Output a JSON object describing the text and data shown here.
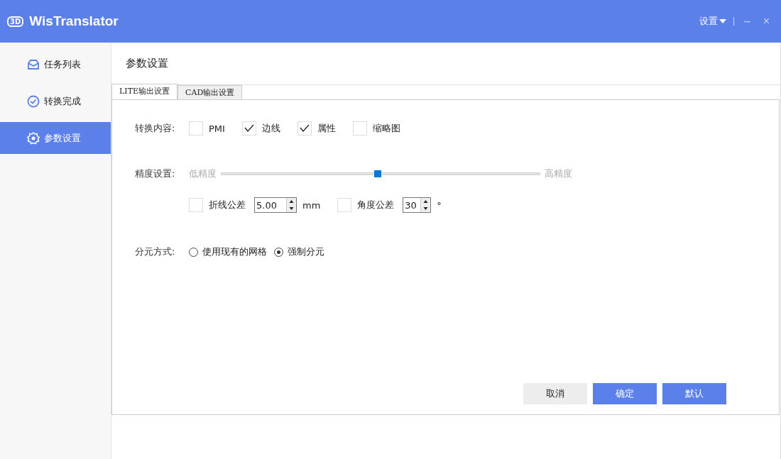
{
  "app": {
    "logo": "3D",
    "title": "WisTranslator"
  },
  "window_controls": {
    "settings_menu": "设置",
    "minimize": "–",
    "close": "×"
  },
  "sidebar": {
    "items": [
      {
        "label": "任务列表",
        "kind": "inbox",
        "selected": false
      },
      {
        "label": "转换完成",
        "kind": "check",
        "selected": false
      },
      {
        "label": "参数设置",
        "kind": "gear",
        "selected": true
      }
    ]
  },
  "page_title": "参数设置",
  "tabs": [
    {
      "label": "LITE输出设置",
      "selected": true
    },
    {
      "label": "CAD输出设置",
      "selected": false
    }
  ],
  "convert_content": {
    "label": "转换内容:",
    "options": [
      {
        "label": "PMI",
        "checked": false
      },
      {
        "label": "边线",
        "checked": true
      },
      {
        "label": "属性",
        "checked": true
      },
      {
        "label": "缩略图",
        "checked": false
      }
    ]
  },
  "precision": {
    "label": "精度设置:",
    "low_label": "低精度",
    "high_label": "高精度",
    "level": 0.49
  },
  "tolerances": [
    {
      "label": "折线公差",
      "checked": false,
      "value": "5.00",
      "unit": "mm"
    },
    {
      "label": "角度公差",
      "checked": false,
      "value": "30",
      "unit": "°"
    }
  ],
  "tessellation": {
    "label": "分元方式:",
    "options": [
      {
        "label": "使用现有的网格",
        "selected": false
      },
      {
        "label": "强制分元",
        "selected": true
      }
    ]
  },
  "buttons": [
    {
      "label": "取消",
      "kind": "secondary"
    },
    {
      "label": "确定",
      "kind": "primary"
    },
    {
      "label": "默认",
      "kind": "primary"
    }
  ]
}
